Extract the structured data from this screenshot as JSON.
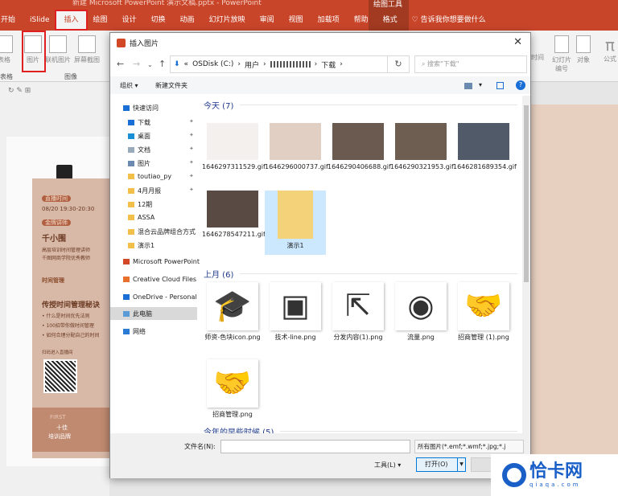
{
  "app": {
    "title": "新建 Microsoft PowerPoint 演示文稿.pptx - PowerPoint",
    "context_group": "绘图工具",
    "accent": "#c8452a"
  },
  "tabs": [
    {
      "label": "开始"
    },
    {
      "label": "iSlide"
    },
    {
      "label": "插入"
    },
    {
      "label": "绘图"
    },
    {
      "label": "设计"
    },
    {
      "label": "切换"
    },
    {
      "label": "动画"
    },
    {
      "label": "幻灯片放映"
    },
    {
      "label": "审阅"
    },
    {
      "label": "视图"
    },
    {
      "label": "加载项"
    },
    {
      "label": "帮助"
    },
    {
      "label": "格式"
    },
    {
      "label": "告诉我你想要做什么"
    }
  ],
  "ribbon": {
    "table": "表格",
    "table_group": "表格",
    "picture": "图片",
    "online_picture": "联机图片",
    "screenshot": "屏幕截图",
    "image_group": "图像",
    "time": "时间",
    "slide_number": "幻灯片编号",
    "object": "对象",
    "formula": "公式"
  },
  "poster": {
    "tag1": "直播时间",
    "time": "08/20  19:30-20:30",
    "tag2": "金牌讲师",
    "name": "千小围",
    "desc1": "高层培训时间管理讲师",
    "desc2": "千图网商学院优秀教师",
    "headline": "时间管理",
    "subhead": "传授时间管理秘诀",
    "bullet1": "• 什么是时间优先法则",
    "bullet2": "• 100招带你做时间管理",
    "bullet3": "• 如何合理分配自己的时间",
    "scan": "扫码进入直播间",
    "foot_en": "FIRST",
    "foot1": "十佳",
    "foot2": "培训品牌"
  },
  "dialog": {
    "title": "插入图片",
    "close": "✕",
    "address": {
      "segments": [
        "OSDisk (C:)",
        "用户",
        "下载"
      ]
    },
    "search_placeholder": "搜索\"下载\"",
    "toolbar": {
      "organize": "组织 ▾",
      "new_folder": "新建文件夹"
    },
    "nav": [
      {
        "label": "快速访问",
        "color": "#1a6fd6"
      },
      {
        "label": "下载",
        "color": "#1a6fd6",
        "pinned": true
      },
      {
        "label": "桌面",
        "color": "#1a8fd6",
        "pinned": true
      },
      {
        "label": "文档",
        "color": "#9ab",
        "pinned": true
      },
      {
        "label": "图片",
        "color": "#6a8ab0",
        "pinned": true
      },
      {
        "label": "toutiao_py",
        "color": "#f2c04a",
        "pinned": true
      },
      {
        "label": "4月月报",
        "color": "#f2c04a",
        "pinned": true
      },
      {
        "label": "12期",
        "color": "#f2c04a"
      },
      {
        "label": "ASSA",
        "color": "#f2c04a"
      },
      {
        "label": "混合云品牌组合方式",
        "color": "#f2c04a"
      },
      {
        "label": "演示1",
        "color": "#f2c04a"
      },
      {
        "label": "Microsoft PowerPoint",
        "color": "#d24726"
      },
      {
        "label": "Creative Cloud Files",
        "color": "#e8702a"
      },
      {
        "label": "OneDrive - Personal",
        "color": "#1a6fd6"
      },
      {
        "label": "此电脑",
        "color": "#5a9ad6",
        "selected": true
      },
      {
        "label": "网络",
        "color": "#2a7ad6"
      }
    ],
    "sections": [
      {
        "label": "今天 (7)"
      },
      {
        "label": "上月 (6)"
      },
      {
        "label": "今年的早些时候 (5)"
      }
    ],
    "today": [
      {
        "name": "1646297311529.gif",
        "bg": "#f4f0ee"
      },
      {
        "name": "1646296000737.gif",
        "bg": "#e2cfc4"
      },
      {
        "name": "1646290406688.gif",
        "bg": "#6a5a50"
      },
      {
        "name": "1646290321953.gif",
        "bg": "#6e5e52"
      },
      {
        "name": "1646281689354.gif",
        "bg": "#505a68"
      },
      {
        "name": "1646278547211.gif",
        "bg": "#5a4a44"
      },
      {
        "name": "演示1",
        "bg": "#f4d27a",
        "selected": true
      }
    ],
    "last_month": [
      {
        "name": "师资-色块icon.png",
        "glyph": "🎓"
      },
      {
        "name": "技术-line.png",
        "glyph": "▣"
      },
      {
        "name": "分发内容(1).png",
        "glyph": "⇱"
      },
      {
        "name": "流量.png",
        "glyph": "◉"
      },
      {
        "name": "招商管理 (1).png",
        "glyph": "🤝"
      },
      {
        "name": "招商管理.png",
        "glyph": "🤝"
      }
    ],
    "filename_label": "文件名(N):",
    "filename_value": "",
    "filetype": "所有图片(*.emf;*.wmf;*.jpg;*.j",
    "tools": "工具(L)  ▾",
    "open": "打开(O)",
    "cancel": "取消"
  },
  "watermark": {
    "text": "恰卡网",
    "sub": "qiaqa.com"
  }
}
